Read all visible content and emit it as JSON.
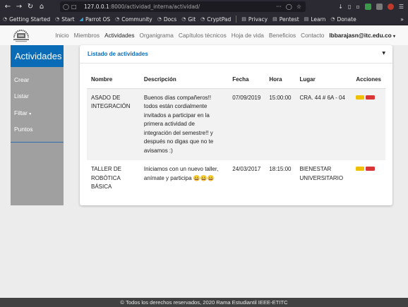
{
  "browser": {
    "url_host": "127.0.0.1",
    "url_rest": ":8000/actividad_interna/actividad/",
    "more_label": "···"
  },
  "bookmarks": [
    {
      "label": "Getting Started"
    },
    {
      "label": "Start"
    },
    {
      "label": "Parrot OS"
    },
    {
      "label": "Community"
    },
    {
      "label": "Docs"
    },
    {
      "label": "Git"
    },
    {
      "label": "CryptPad"
    },
    {
      "label": "Privacy"
    },
    {
      "label": "Pentest"
    },
    {
      "label": "Learn"
    },
    {
      "label": "Donate"
    }
  ],
  "nav": {
    "links": [
      "Inicio",
      "Miembros",
      "Actividades",
      "Organigrama",
      "Capítulos técnicos",
      "Hoja de vida",
      "Beneficios",
      "Contacto"
    ],
    "user": "lbbarajasn@itc.edu.co"
  },
  "sidebar": {
    "title": "Actividades",
    "items": [
      "Crear",
      "Listar",
      "Filtar",
      "Puntos"
    ]
  },
  "card": {
    "title": "Listado de actividades"
  },
  "table": {
    "headers": [
      "Nombre",
      "Descripción",
      "Fecha",
      "Hora",
      "Lugar",
      "Acciones"
    ],
    "rows": [
      {
        "nombre": "ASADO DE INTEGRACIÓN",
        "descripcion": "Buenos días compañeros!! todos están cordialmente invitados a participar en la primera actividad de integración del semestre!! y después no digas que no te avisamos :)",
        "fecha": "07/09/2019",
        "hora": "15:00:00",
        "lugar": "CRA. 44 # 6A - 04"
      },
      {
        "nombre": "TALLER DE ROBÓTICA BÁSICA",
        "descripcion": "Iniciamos con un nuevo taller, anímate y participa 😀😀😀",
        "fecha": "24/03/2017",
        "hora": "18:15:00",
        "lugar": "BIENESTAR UNIVERSITARIO"
      }
    ]
  },
  "footer": {
    "text": "© Todos los derechos reservados, 2020 Rama Estudiantil IEEE-ETITC"
  },
  "colors": {
    "primary": "#0a6bb7",
    "sidebar": "#a0a0a0",
    "edit": "#f0c000",
    "delete": "#d93636"
  }
}
